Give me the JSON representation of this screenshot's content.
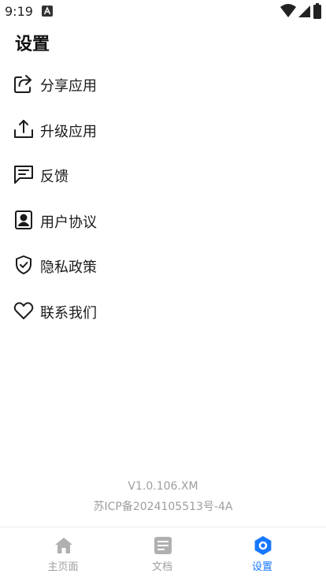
{
  "status_bar": {
    "time": "9:19",
    "icons": [
      "notification-a-icon",
      "wifi-icon",
      "cellular-signal-icon",
      "battery-icon"
    ]
  },
  "page": {
    "title": "设置"
  },
  "menu": {
    "items": [
      {
        "label": "分享应用",
        "icon": "share-icon"
      },
      {
        "label": "升级应用",
        "icon": "upload-icon"
      },
      {
        "label": "反馈",
        "icon": "feedback-icon"
      },
      {
        "label": "用户协议",
        "icon": "user-agreement-icon"
      },
      {
        "label": "隐私政策",
        "icon": "privacy-shield-icon"
      },
      {
        "label": "联系我们",
        "icon": "heart-icon"
      }
    ]
  },
  "footer": {
    "version": "V1.0.106.XM",
    "icp": "苏ICP备2024105513号-4A"
  },
  "bottom_nav": {
    "items": [
      {
        "label": "主页面",
        "icon": "home-icon",
        "active": false
      },
      {
        "label": "文档",
        "icon": "document-icon",
        "active": false
      },
      {
        "label": "设置",
        "icon": "settings-icon",
        "active": true
      }
    ]
  },
  "colors": {
    "accent": "#1677ff",
    "inactive": "#9e9e9e",
    "text": "#1a1a1a",
    "icon_gray": "#b0b0b0"
  }
}
